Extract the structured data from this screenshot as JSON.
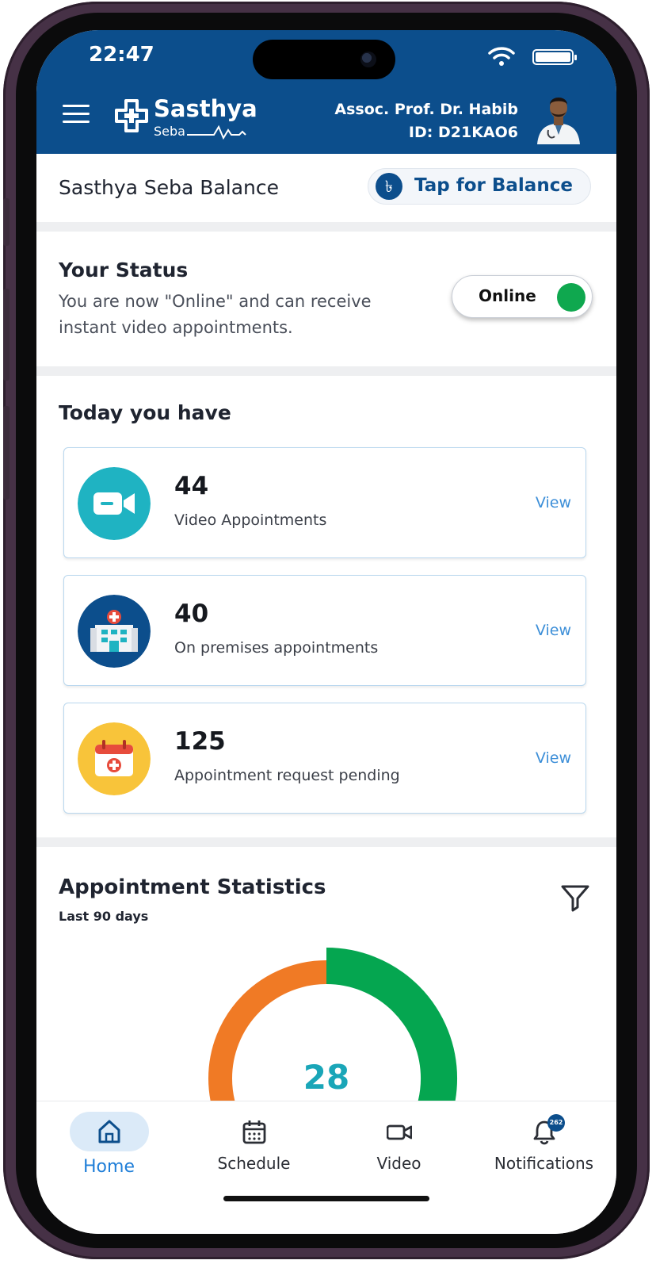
{
  "status_bar": {
    "time": "22:47"
  },
  "header": {
    "logo_title": "Sasthya",
    "logo_subtitle": "Seba",
    "doctor_name": "Assoc. Prof. Dr. Habib",
    "doctor_id": "ID: D21KAO6"
  },
  "balance": {
    "title": "Sasthya Seba Balance",
    "currency_symbol": "৳",
    "button_label": "Tap for Balance"
  },
  "status": {
    "title": "Your Status",
    "description": "You are now \"Online\" and can receive instant video appointments.",
    "toggle_label": "Online",
    "toggle_on": true
  },
  "today": {
    "title": "Today you have",
    "cards": [
      {
        "count": "44",
        "label": "Video Appointments",
        "view": "View",
        "icon": "video-camera-icon",
        "color": "#1fb3c2"
      },
      {
        "count": "40",
        "label": "On premises appointments",
        "view": "View",
        "icon": "hospital-building-icon",
        "color": "#0c4e8c"
      },
      {
        "count": "125",
        "label": "Appointment request pending",
        "view": "View",
        "icon": "calendar-plus-icon",
        "color": "#f8c43a"
      }
    ]
  },
  "statistics": {
    "title": "Appointment Statistics",
    "subtitle": "Last 90 days",
    "center_value": "28"
  },
  "chart_data": {
    "type": "pie",
    "center_label": "28",
    "segments": [
      {
        "color": "#05a650"
      },
      {
        "color": "#f07a25"
      }
    ]
  },
  "tabs": [
    {
      "label": "Home",
      "icon": "home-icon",
      "active": true
    },
    {
      "label": "Schedule",
      "icon": "calendar-icon",
      "active": false
    },
    {
      "label": "Video",
      "icon": "video-icon",
      "active": false
    },
    {
      "label": "Notifications",
      "icon": "bell-icon",
      "active": false,
      "badge": "262"
    }
  ],
  "colors": {
    "primary": "#0c4e8c",
    "accent_green": "#0fa84f",
    "link": "#3d8fd8"
  }
}
